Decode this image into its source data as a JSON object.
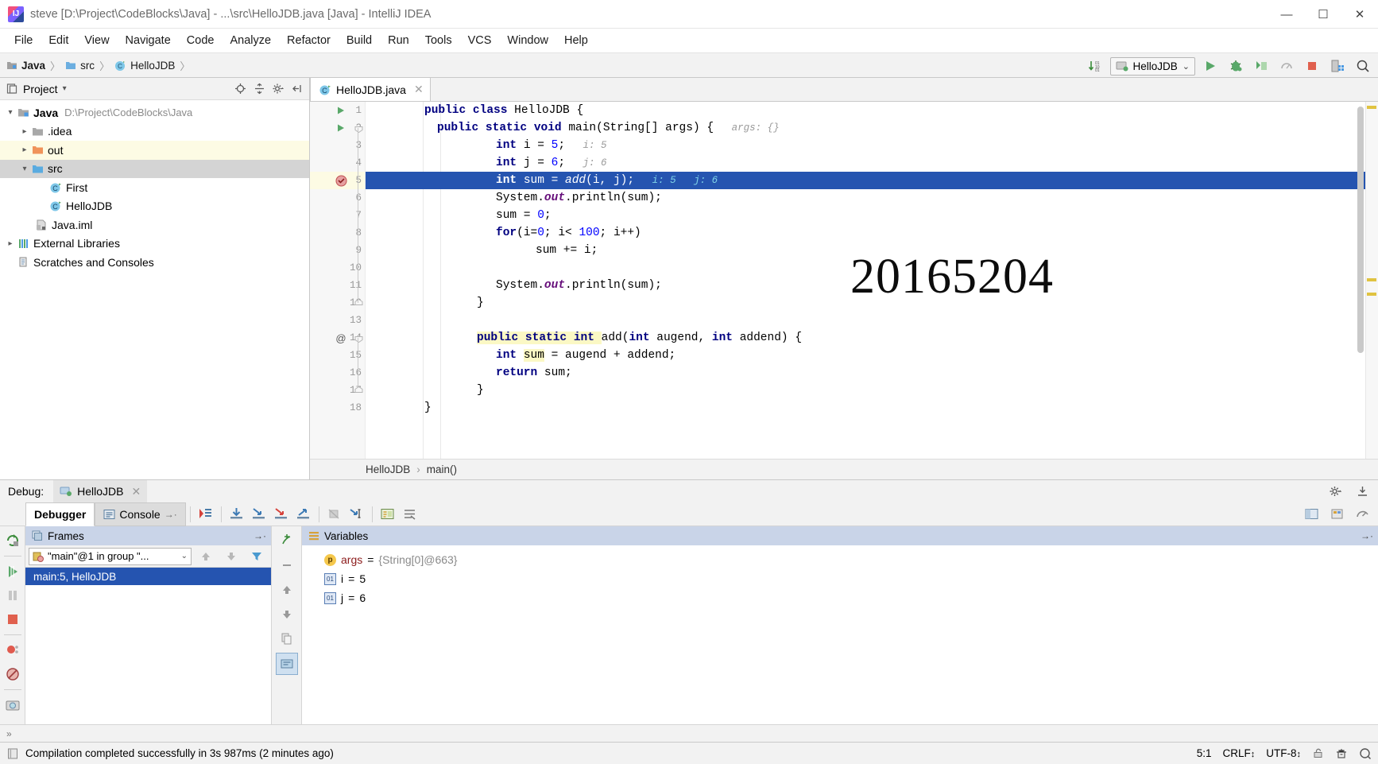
{
  "window": {
    "title": "steve [D:\\Project\\CodeBlocks\\Java] - ...\\src\\HelloJDB.java [Java] - IntelliJ IDEA",
    "app_icon": "intellij-idea-icon",
    "minimize": "—",
    "maximize": "☐",
    "close": "✕"
  },
  "menubar": [
    {
      "label": "File"
    },
    {
      "label": "Edit"
    },
    {
      "label": "View"
    },
    {
      "label": "Navigate"
    },
    {
      "label": "Code"
    },
    {
      "label": "Analyze"
    },
    {
      "label": "Refactor"
    },
    {
      "label": "Build"
    },
    {
      "label": "Run"
    },
    {
      "label": "Tools"
    },
    {
      "label": "VCS"
    },
    {
      "label": "Window"
    },
    {
      "label": "Help"
    }
  ],
  "navbar": {
    "breadcrumb": [
      {
        "label": "Java",
        "icon": "module-icon",
        "bold": true
      },
      {
        "label": "src",
        "icon": "source-folder-icon",
        "bold": false
      },
      {
        "label": "HelloJDB",
        "icon": "java-class-icon",
        "bold": false
      }
    ],
    "sep": "〉",
    "run_config": "HelloJDB",
    "run_config_icon": "run-config-icon",
    "chevron": "⌄",
    "buttons": [
      {
        "name": "sort-lines-icon",
        "label": "↓"
      },
      {
        "name": "run-button",
        "label": "▶"
      },
      {
        "name": "debug-button",
        "label": "bug"
      },
      {
        "name": "coverage-button",
        "label": "coverage"
      },
      {
        "name": "profiler-button",
        "label": "profiler"
      },
      {
        "name": "stop-button",
        "label": "■"
      },
      {
        "name": "build-project-button",
        "label": "build"
      },
      {
        "name": "search-everywhere-icon",
        "label": "⌕"
      }
    ]
  },
  "project_panel": {
    "title": "Project",
    "title_icon": "project-view-icon",
    "chevron": "▾",
    "header_buttons": [
      {
        "name": "locate-file-icon",
        "glyph": "⊕"
      },
      {
        "name": "expand-collapse-icon",
        "glyph": "⨍"
      },
      {
        "name": "settings-gear-icon",
        "glyph": "⚙"
      },
      {
        "name": "hide-panel-icon",
        "glyph": "←"
      }
    ],
    "tree": [
      {
        "label": "Java",
        "path": "D:\\Project\\CodeBlocks\\Java",
        "icon": "module-icon",
        "arrow": "expanded",
        "indent": 0,
        "bold": true,
        "state": "normal"
      },
      {
        "label": ".idea",
        "path": "",
        "icon": "folder-icon",
        "arrow": "collapsed",
        "indent": 1,
        "bold": false,
        "state": "normal"
      },
      {
        "label": "out",
        "path": "",
        "icon": "folder-orange-icon",
        "arrow": "collapsed",
        "indent": 1,
        "bold": false,
        "state": "highlight"
      },
      {
        "label": "src",
        "path": "",
        "icon": "source-folder-icon",
        "arrow": "expanded",
        "indent": 1,
        "bold": false,
        "state": "selected"
      },
      {
        "label": "First",
        "path": "",
        "icon": "java-class-icon",
        "arrow": "none",
        "indent": 2,
        "bold": false,
        "state": "normal"
      },
      {
        "label": "HelloJDB",
        "path": "",
        "icon": "java-class-icon",
        "arrow": "none",
        "indent": 2,
        "bold": false,
        "state": "normal"
      },
      {
        "label": "Java.iml",
        "path": "",
        "icon": "iml-file-icon",
        "arrow": "none",
        "indent": 1,
        "bold": false,
        "state": "normal"
      },
      {
        "label": "External Libraries",
        "path": "",
        "icon": "libraries-icon",
        "arrow": "collapsed",
        "indent": 0,
        "bold": false,
        "state": "normal"
      },
      {
        "label": "Scratches and Consoles",
        "path": "",
        "icon": "scratches-icon",
        "arrow": "none",
        "indent": 0,
        "bold": false,
        "state": "normal"
      }
    ]
  },
  "editor": {
    "tab": {
      "label": "HelloJDB.java",
      "icon": "java-class-icon",
      "close": "✕"
    },
    "watermark": "20165204",
    "breadcrumb": [
      "HelloJDB",
      "main()"
    ],
    "breadcrumb_sep": "›",
    "lines": [
      {
        "n": "1",
        "mark": "run-gutter-icon",
        "fold": "",
        "indent": 0,
        "tokens": [
          {
            "t": "public ",
            "c": "kw"
          },
          {
            "t": "class ",
            "c": "kw"
          },
          {
            "t": "HelloJDB {",
            "c": ""
          }
        ]
      },
      {
        "n": "2",
        "mark": "run-gutter-icon",
        "fold": "fold-end",
        "indent": 1,
        "tokens": [
          {
            "t": "public static void ",
            "c": "kw"
          },
          {
            "t": "main(String[] args) {",
            "c": ""
          },
          {
            "t": "   args: {}",
            "c": "hint"
          }
        ]
      },
      {
        "n": "3",
        "mark": "",
        "fold": "",
        "indent": 3,
        "tokens": [
          {
            "t": "int ",
            "c": "kw"
          },
          {
            "t": "i = ",
            "c": ""
          },
          {
            "t": "5",
            "c": "num"
          },
          {
            "t": ";",
            "c": ""
          },
          {
            "t": "   i: 5",
            "c": "hint"
          }
        ]
      },
      {
        "n": "4",
        "mark": "",
        "fold": "",
        "indent": 3,
        "tokens": [
          {
            "t": "int ",
            "c": "kw"
          },
          {
            "t": "j = ",
            "c": ""
          },
          {
            "t": "6",
            "c": "num"
          },
          {
            "t": ";",
            "c": ""
          },
          {
            "t": "   j: 6",
            "c": "hint"
          }
        ]
      },
      {
        "n": "5",
        "mark": "breakpoint-icon",
        "fold": "",
        "indent": 3,
        "exec": true,
        "tokens": [
          {
            "t": "int ",
            "c": "kw"
          },
          {
            "t": "sum = ",
            "c": ""
          },
          {
            "t": "add",
            "c": "mth"
          },
          {
            "t": "(i, j);",
            "c": ""
          },
          {
            "t": "   i: 5   j: 6",
            "c": "hint"
          }
        ]
      },
      {
        "n": "6",
        "mark": "",
        "fold": "",
        "indent": 3,
        "tokens": [
          {
            "t": "System.",
            "c": ""
          },
          {
            "t": "out",
            "c": "fld"
          },
          {
            "t": ".println(sum);",
            "c": ""
          }
        ]
      },
      {
        "n": "7",
        "mark": "",
        "fold": "",
        "indent": 3,
        "tokens": [
          {
            "t": "sum = ",
            "c": ""
          },
          {
            "t": "0",
            "c": "num"
          },
          {
            "t": ";",
            "c": ""
          }
        ]
      },
      {
        "n": "8",
        "mark": "",
        "fold": "",
        "indent": 3,
        "tokens": [
          {
            "t": "for",
            "c": "kw"
          },
          {
            "t": "(i=",
            "c": ""
          },
          {
            "t": "0",
            "c": "num"
          },
          {
            "t": "; i< ",
            "c": ""
          },
          {
            "t": "100",
            "c": "num"
          },
          {
            "t": "; i++)",
            "c": ""
          }
        ]
      },
      {
        "n": "9",
        "mark": "",
        "fold": "",
        "indent": 5,
        "tokens": [
          {
            "t": "sum += i;",
            "c": ""
          }
        ]
      },
      {
        "n": "10",
        "mark": "",
        "fold": "",
        "indent": 0,
        "tokens": []
      },
      {
        "n": "11",
        "mark": "",
        "fold": "",
        "indent": 3,
        "tokens": [
          {
            "t": "System.",
            "c": ""
          },
          {
            "t": "out",
            "c": "fld"
          },
          {
            "t": ".println(sum);",
            "c": ""
          }
        ]
      },
      {
        "n": "12",
        "mark": "",
        "fold": "fold-start",
        "indent": 1,
        "tokens": [
          {
            "t": "}",
            "c": ""
          }
        ]
      },
      {
        "n": "13",
        "mark": "",
        "fold": "",
        "indent": 0,
        "tokens": []
      },
      {
        "n": "14",
        "mark": "override-icon",
        "fold": "fold-end",
        "indent": 1,
        "tokens": [
          {
            "t": "public static int ",
            "c": "kw hl"
          },
          {
            "t": "add(",
            "c": ""
          },
          {
            "t": "int ",
            "c": "kw"
          },
          {
            "t": "augend, ",
            "c": ""
          },
          {
            "t": "int ",
            "c": "kw"
          },
          {
            "t": "addend) {",
            "c": ""
          }
        ]
      },
      {
        "n": "15",
        "mark": "",
        "fold": "",
        "indent": 2,
        "tokens": [
          {
            "t": "int ",
            "c": "kw"
          },
          {
            "t": "sum",
            "c": "hl"
          },
          {
            "t": " = augend + addend;",
            "c": ""
          }
        ]
      },
      {
        "n": "16",
        "mark": "",
        "fold": "",
        "indent": 2,
        "tokens": [
          {
            "t": "return ",
            "c": "kw"
          },
          {
            "t": "sum;",
            "c": ""
          }
        ]
      },
      {
        "n": "17",
        "mark": "",
        "fold": "fold-start",
        "indent": 1,
        "tokens": [
          {
            "t": "}",
            "c": ""
          }
        ]
      },
      {
        "n": "18",
        "mark": "",
        "fold": "",
        "indent": 0,
        "tokens": [
          {
            "t": "}",
            "c": ""
          }
        ]
      }
    ]
  },
  "debug": {
    "label": "Debug:",
    "session": "HelloJDB",
    "session_icon": "debug-session-icon",
    "close": "✕",
    "tabs": [
      {
        "label": "Debugger",
        "icon": "",
        "active": true
      },
      {
        "label": "Console",
        "icon": "console-icon",
        "active": false,
        "suffix": "→·"
      }
    ],
    "stepping_buttons": [
      {
        "name": "show-execution-point-icon"
      },
      {
        "name": "step-over-icon"
      },
      {
        "name": "step-into-icon"
      },
      {
        "name": "force-step-into-icon"
      },
      {
        "name": "step-out-icon"
      },
      {
        "name": "drop-frame-icon"
      },
      {
        "name": "run-to-cursor-icon"
      },
      {
        "name": "evaluate-expression-icon"
      },
      {
        "name": "mute-breakpoints-icon"
      }
    ],
    "left_buttons": [
      {
        "name": "rerun-debug-icon"
      },
      {
        "name": "resume-program-icon"
      },
      {
        "name": "pause-program-icon"
      },
      {
        "name": "stop-session-icon"
      },
      {
        "name": "view-breakpoints-icon"
      },
      {
        "name": "mute-breakpoints-toggle-icon"
      },
      {
        "name": "screenshot-icon"
      }
    ],
    "right_buttons": [
      {
        "name": "layout-settings-icon"
      },
      {
        "name": "pin-tab-icon"
      },
      {
        "name": "help-icon"
      }
    ],
    "settings_icon": "gear-icon",
    "hide_icon": "hide-icon",
    "frames": {
      "title": "Frames",
      "title_icon": "frames-icon",
      "hide": "→·",
      "thread": "\"main\"@1 in group \"...",
      "thread_icon": "thread-suspended-icon",
      "thread_chevron": "⌄",
      "nav": [
        {
          "name": "frame-up-icon",
          "glyph": "↑"
        },
        {
          "name": "frame-down-icon",
          "glyph": "↓"
        },
        {
          "name": "filter-frames-icon",
          "glyph": "filter"
        }
      ],
      "items": [
        {
          "label": "main:5, HelloJDB",
          "selected": true
        }
      ]
    },
    "mid_buttons": [
      {
        "name": "add-watch-icon"
      },
      {
        "name": "remove-watch-icon"
      },
      {
        "name": "watch-up-icon"
      },
      {
        "name": "watch-down-icon"
      },
      {
        "name": "copy-value-icon"
      },
      {
        "name": "inspect-icon"
      }
    ],
    "variables": {
      "title": "Variables",
      "title_icon": "variables-icon",
      "hide": "→·",
      "rows": [
        {
          "badge": "p",
          "name": "args",
          "eq": " = ",
          "value": "{String[0]@663}",
          "value_kind": "ref"
        },
        {
          "badge": "01",
          "name": "i",
          "eq": " = ",
          "value": "5",
          "value_kind": "num"
        },
        {
          "badge": "01",
          "name": "j",
          "eq": " = ",
          "value": "6",
          "value_kind": "num"
        }
      ]
    }
  },
  "statusbar": {
    "icon": "event-log-icon",
    "message": "Compilation completed successfully in 3s 987ms (2 minutes ago)",
    "caret": "5:1",
    "line_sep": "CRLF",
    "line_sep_chev": "↕",
    "encoding": "UTF-8",
    "encoding_chev": "↕",
    "lock_icon": "read-only-lock-icon",
    "inspect_icon": "inspection-hector-icon",
    "search_icon": "search-icon",
    "expand_chev": "»"
  },
  "colors": {
    "accent_blue": "#2554b0",
    "panel_header": "#c9d4e8",
    "highlight_row": "#fdfbe4",
    "keyword": "#000080",
    "number": "#0000ff",
    "field": "#660e7a",
    "hint": "#9a9a9a",
    "error_red": "#d6433b",
    "green": "#59a869"
  }
}
